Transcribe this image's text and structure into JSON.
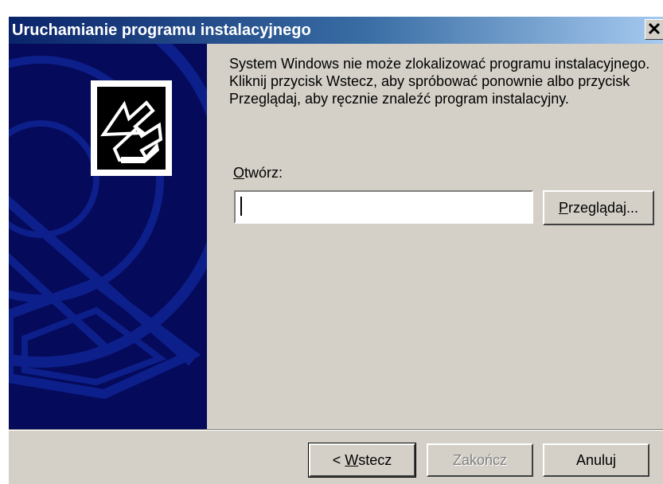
{
  "window": {
    "title": "Uruchamianie programu instalacyjnego",
    "close_glyph": "✕"
  },
  "content": {
    "message": "System Windows nie może zlokalizować programu instalacyjnego. Kliknij przycisk Wstecz, aby spróbować ponownie albo przycisk Przeglądaj, aby ręcznie znaleźć program instalacyjny.",
    "open_label_mnemonic": "O",
    "open_label_rest": "twórz:",
    "open_input_value": "",
    "browse_mnemonic": "P",
    "browse_rest": "rzeglądaj..."
  },
  "footer": {
    "back_prefix": "< ",
    "back_mnemonic": "W",
    "back_rest": "stecz",
    "finish_label": "Zakończ",
    "cancel_label": "Anuluj"
  },
  "colors": {
    "title_gradient_start": "#0a246a",
    "title_gradient_end": "#a6caf0",
    "wizard_pane": "#050a5a",
    "dialog_face": "#d4d0c8"
  },
  "icons": {
    "wizard_logo": "setup-arrows-icon",
    "close": "close-icon"
  }
}
